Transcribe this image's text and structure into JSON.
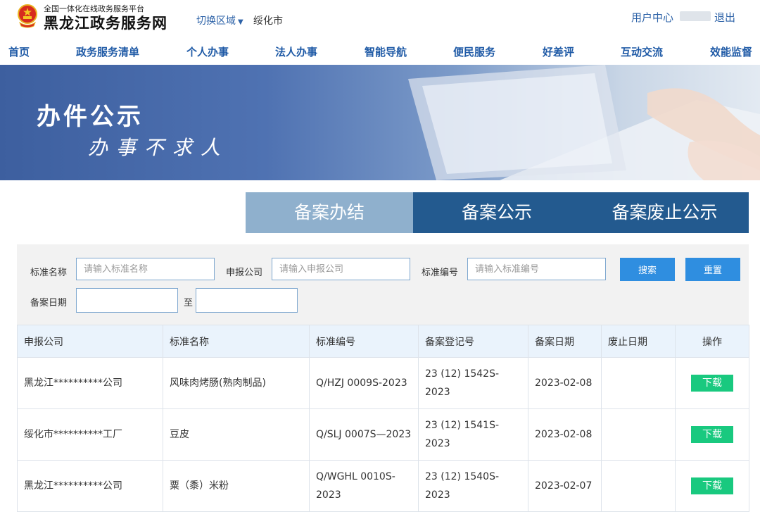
{
  "header": {
    "platform_subtitle": "全国一体化在线政务服务平台",
    "site_title": "黑龙江政务服务网",
    "region_switch_label": "切换区域",
    "current_region": "绥化市",
    "user_center_label": "用户中心",
    "logout_label": "退出",
    "icon_names": [
      "national-emblem-icon",
      "triangle-down-icon"
    ]
  },
  "nav": {
    "items": [
      "首页",
      "政务服务清单",
      "个人办事",
      "法人办事",
      "智能导航",
      "便民服务",
      "好差评",
      "互动交流",
      "效能监督"
    ]
  },
  "banner": {
    "title": "办件公示",
    "slogan": "办事不求人"
  },
  "tabs": [
    {
      "label": "备案办结",
      "active": false
    },
    {
      "label": "备案公示",
      "active": true
    },
    {
      "label": "备案废止公示",
      "active": false
    }
  ],
  "filter": {
    "standard_name_label": "标准名称",
    "standard_name_placeholder": "请输入标准名称",
    "company_label": "申报公司",
    "company_placeholder": "请输入申报公司",
    "standard_no_label": "标准编号",
    "standard_no_placeholder": "请输入标准编号",
    "search_label": "搜索",
    "reset_label": "重置",
    "date_label": "备案日期",
    "date_to_label": "至",
    "date_from_value": "",
    "date_to_value": ""
  },
  "table": {
    "headers": [
      "申报公司",
      "标准名称",
      "标准编号",
      "备案登记号",
      "备案日期",
      "废止日期",
      "操作"
    ],
    "rows": [
      {
        "company": "黑龙江**********公司",
        "name": "风味肉烤肠(熟肉制品)",
        "standard_no": "Q/HZJ 0009S-2023",
        "reg_no": "23 (12) 1542S-2023",
        "date": "2023-02-08",
        "abolish_date": "",
        "action": "下载"
      },
      {
        "company": "绥化市**********工厂",
        "name": "豆皮",
        "standard_no": "Q/SLJ 0007S—2023",
        "reg_no": "23 (12) 1541S-2023",
        "date": "2023-02-08",
        "abolish_date": "",
        "action": "下载"
      },
      {
        "company": "黑龙江**********公司",
        "name": "粟（黍）米粉",
        "standard_no": "Q/WGHL 0010S-2023",
        "reg_no": "23 (12) 1540S-2023",
        "date": "2023-02-07",
        "abolish_date": "",
        "action": "下载"
      }
    ]
  },
  "colors": {
    "brand_blue": "#1f5aa6",
    "tab_active": "#235a8f",
    "tab_inactive": "#8fb0cd",
    "button_blue": "#2f8ee0",
    "download_green": "#19c97f"
  }
}
